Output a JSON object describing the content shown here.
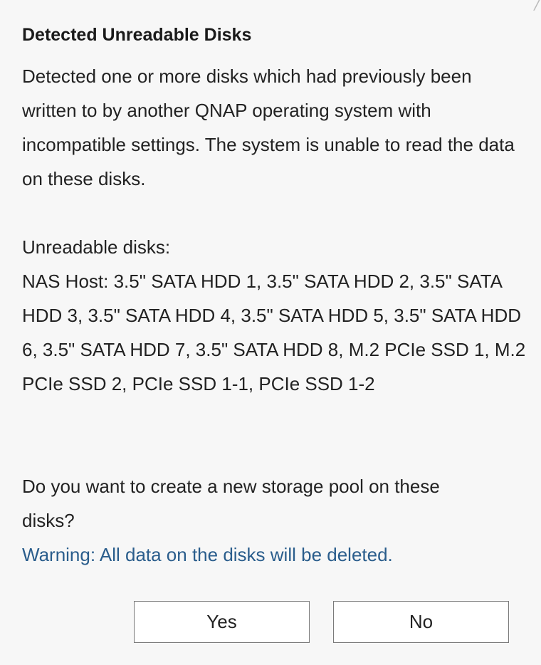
{
  "dialog": {
    "close_icon": "close-icon",
    "title": "Detected Unreadable Disks",
    "message": "Detected one or more disks which had previously been written to by another QNAP operating system with incompatible settings. The system is unable to read the data on these disks.",
    "disks_label": "Unreadable disks:",
    "disks_list": "NAS Host: 3.5\" SATA HDD 1, 3.5\" SATA HDD 2, 3.5\" SATA HDD 3, 3.5\" SATA HDD 4, 3.5\" SATA HDD 5, 3.5\" SATA HDD 6, 3.5\" SATA HDD 7, 3.5\" SATA HDD 8, M.2 PCIe SSD 1, M.2 PCIe SSD 2, PCIe SSD 1-1, PCIe SSD 1-2",
    "question": "Do you want to create a new storage pool on these disks?",
    "warning": "Warning: All data on the disks will be deleted.",
    "yes_label": "Yes",
    "no_label": "No"
  },
  "colors": {
    "background": "#f7f7f7",
    "warning_text": "#2a5d8c",
    "button_border": "#7a7a7a"
  }
}
